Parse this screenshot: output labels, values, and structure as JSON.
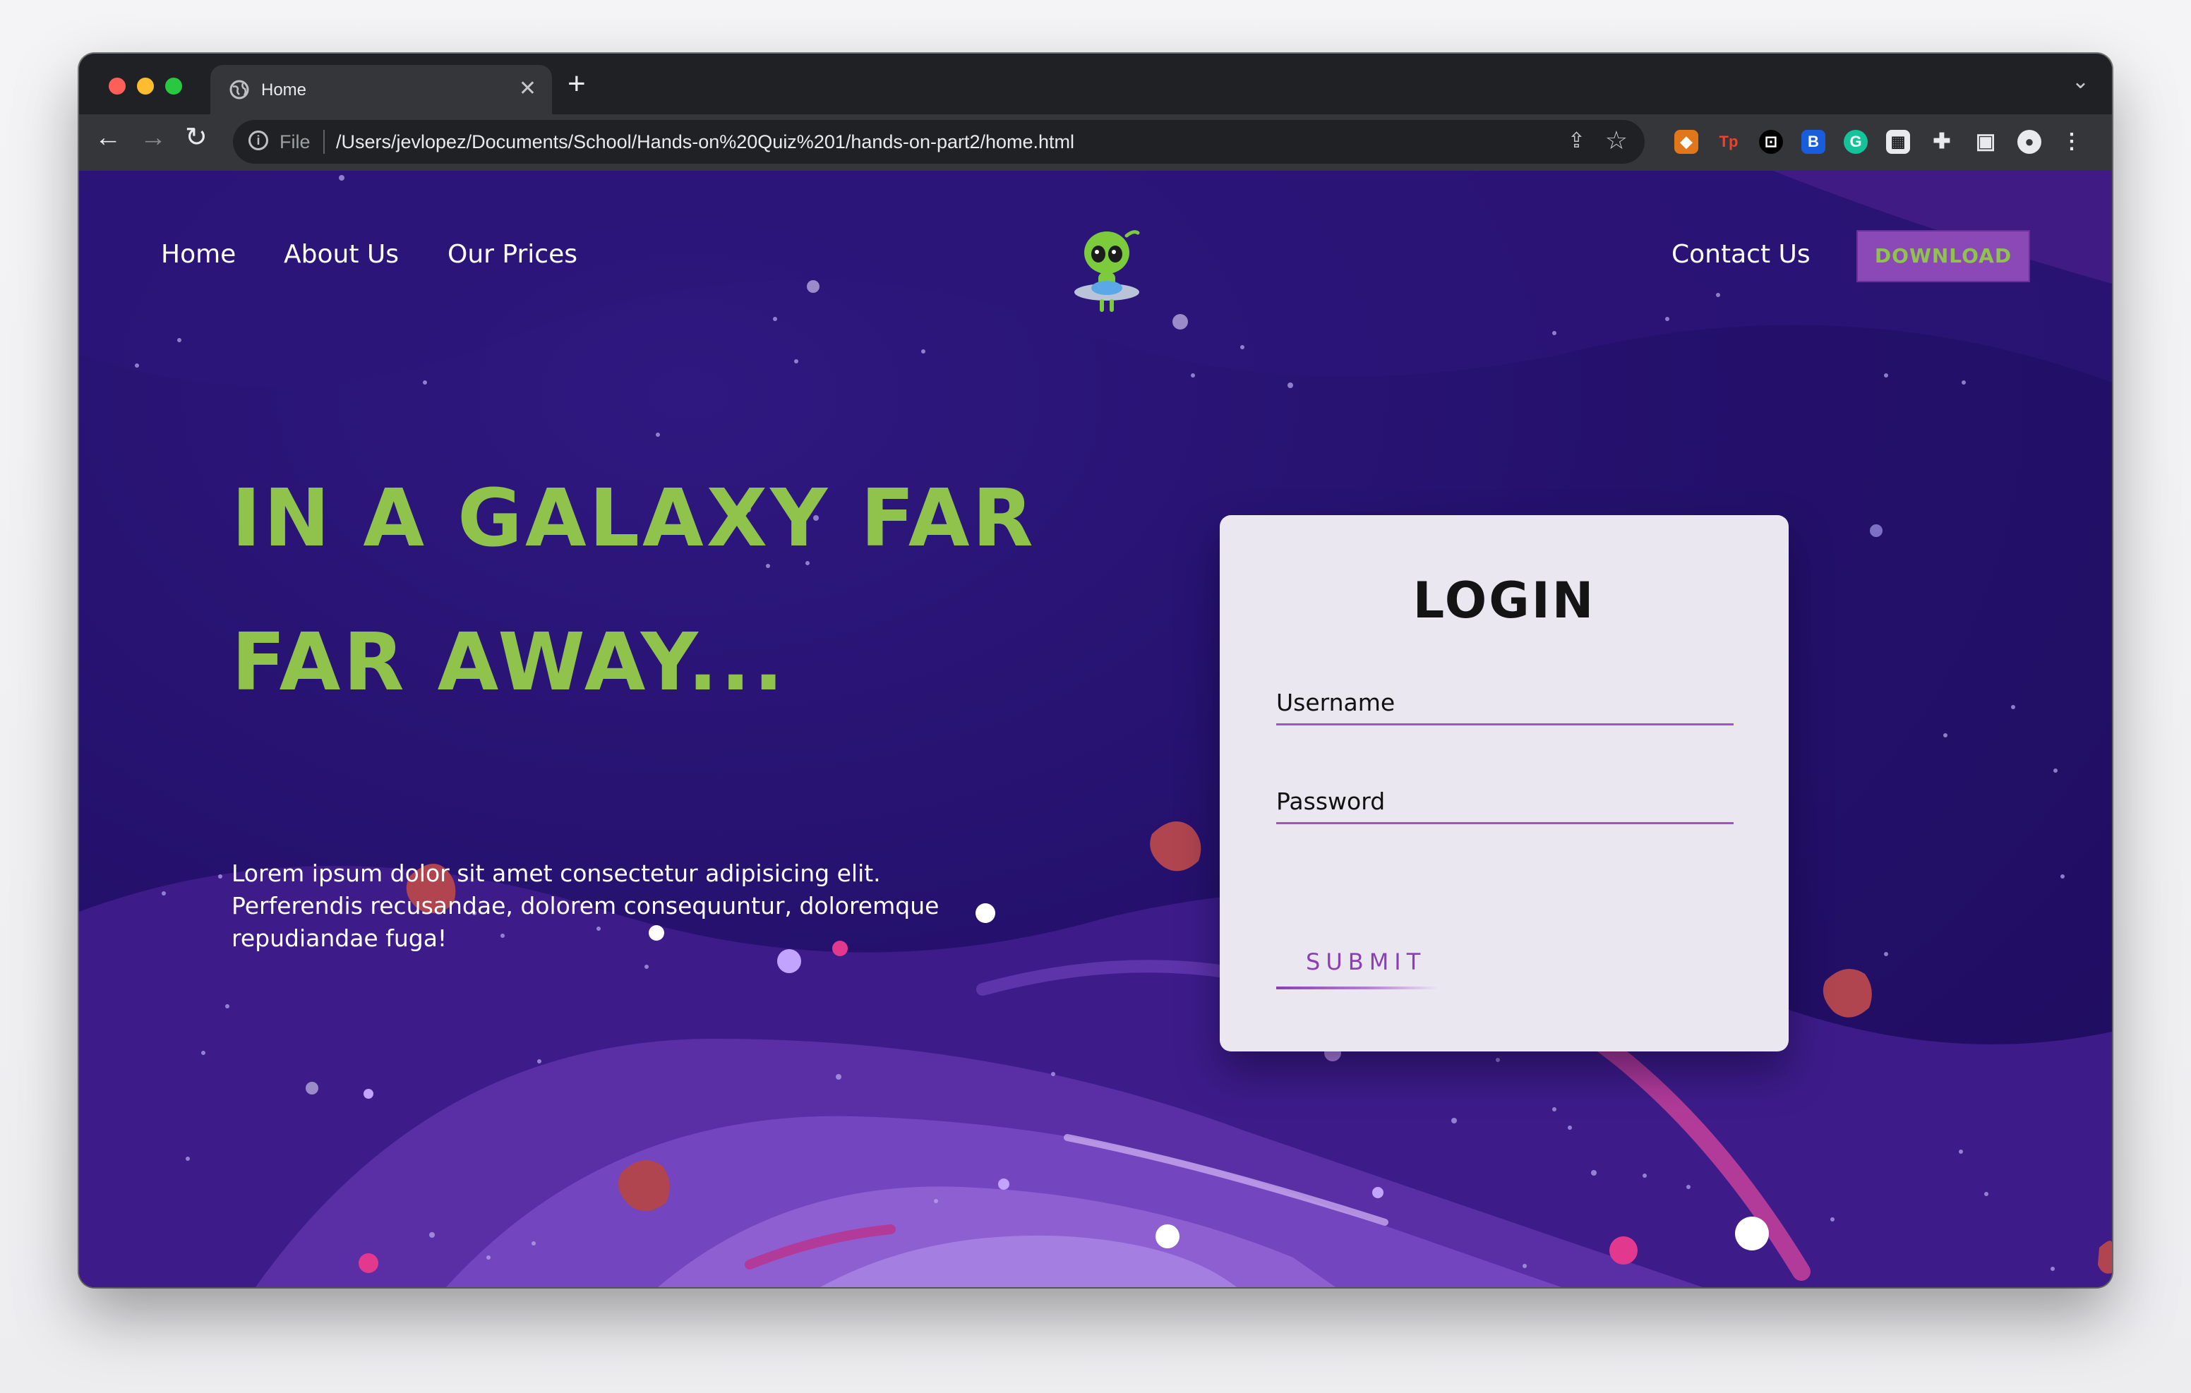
{
  "browser": {
    "tab_title": "Home",
    "new_tab": "+",
    "omnibox_scheme": "File",
    "url": "/Users/jevlopez/Documents/School/Hands-on%20Quiz%201/hands-on-part2/home.html",
    "extensions": [
      "metamask-icon",
      "tp-icon",
      "lock-icon",
      "bitwarden-icon",
      "grammarly-icon",
      "qr-icon",
      "puzzle-icon",
      "sidepanel-icon",
      "profile-icon"
    ]
  },
  "page": {
    "nav": {
      "home": "Home",
      "about": "About Us",
      "prices": "Our Prices",
      "contact": "Contact Us",
      "download": "DOWNLOAD"
    },
    "hero": {
      "line1": "IN A GALAXY FAR",
      "line2": "FAR AWAY...",
      "paragraph": "Lorem ipsum dolor sit amet consectetur adipisicing elit. Perferendis recusandae, dolorem consequuntur, doloremque repudiandae fuga!"
    },
    "login": {
      "title": "LOGIN",
      "username_placeholder": "Username",
      "password_placeholder": "Password",
      "submit": "SUBMIT"
    },
    "colors": {
      "accent_green": "#8fc34c",
      "accent_purple": "#8b49b8",
      "background": "#25116d"
    }
  }
}
